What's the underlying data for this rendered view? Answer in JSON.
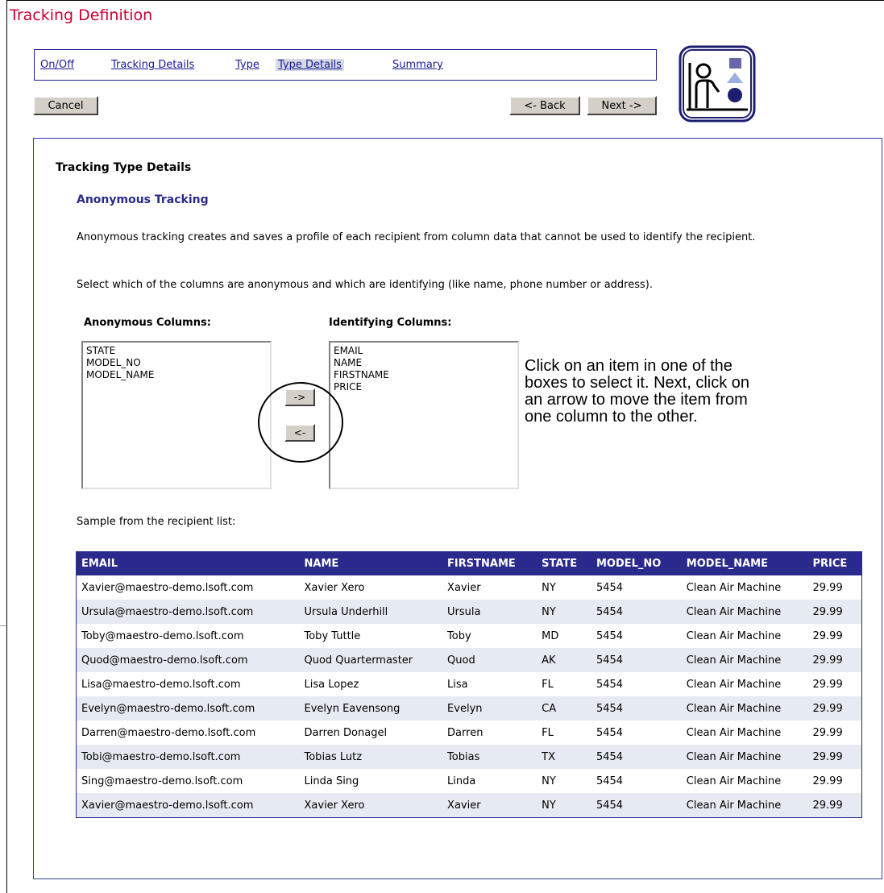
{
  "page": {
    "title": "Tracking Definition"
  },
  "wizard": {
    "tabs": [
      {
        "label": "On/Off"
      },
      {
        "label": "Tracking Details"
      },
      {
        "label": "Type"
      },
      {
        "label": "Type Details"
      },
      {
        "label": "Summary"
      }
    ],
    "active_tab": "Type Details",
    "cancel_label": "Cancel",
    "back_label": "<- Back",
    "next_label": "Next ->"
  },
  "logo": {
    "icon": "presenter-with-shapes-icon"
  },
  "content": {
    "section_title": "Tracking Type Details",
    "subtitle": "Anonymous Tracking",
    "description": "Anonymous tracking creates and saves a profile of each recipient from column data that cannot be used to identify the recipient.",
    "instruction": "Select which of the columns are anonymous and which are identifying (like name, phone number or address).",
    "anonymous_label": "Anonymous Columns:",
    "identifying_label": "Identifying Columns:",
    "anonymous_columns": [
      "STATE",
      "MODEL_NO",
      "MODEL_NAME"
    ],
    "identifying_columns": [
      "EMAIL",
      "NAME",
      "FIRSTNAME",
      "PRICE"
    ],
    "move_right_label": "->",
    "move_left_label": "<-",
    "hint": "Click on an item in one of the boxes to select it. Next, click on an arrow to move the item from one column to the other.",
    "sample_label": "Sample from the recipient list:"
  },
  "sample_table": {
    "headers": [
      "EMAIL",
      "NAME",
      "FIRSTNAME",
      "STATE",
      "MODEL_NO",
      "MODEL_NAME",
      "PRICE"
    ],
    "rows": [
      [
        "Xavier@maestro-demo.lsoft.com",
        "Xavier Xero",
        "Xavier",
        "NY",
        "5454",
        "Clean Air Machine",
        "29.99"
      ],
      [
        "Ursula@maestro-demo.lsoft.com",
        "Ursula Underhill",
        "Ursula",
        "NY",
        "5454",
        "Clean Air Machine",
        "29.99"
      ],
      [
        "Toby@maestro-demo.lsoft.com",
        "Toby Tuttle",
        "Toby",
        "MD",
        "5454",
        "Clean Air Machine",
        "29.99"
      ],
      [
        "Quod@maestro-demo.lsoft.com",
        "Quod Quartermaster",
        "Quod",
        "AK",
        "5454",
        "Clean Air Machine",
        "29.99"
      ],
      [
        "Lisa@maestro-demo.lsoft.com",
        "Lisa Lopez",
        "Lisa",
        "FL",
        "5454",
        "Clean Air Machine",
        "29.99"
      ],
      [
        "Evelyn@maestro-demo.lsoft.com",
        "Evelyn Eavensong",
        "Evelyn",
        "CA",
        "5454",
        "Clean Air Machine",
        "29.99"
      ],
      [
        "Darren@maestro-demo.lsoft.com",
        "Darren Donagel",
        "Darren",
        "FL",
        "5454",
        "Clean Air Machine",
        "29.99"
      ],
      [
        "Tobi@maestro-demo.lsoft.com",
        "Tobias Lutz",
        "Tobias",
        "TX",
        "5454",
        "Clean Air Machine",
        "29.99"
      ],
      [
        "Sing@maestro-demo.lsoft.com",
        "Linda Sing",
        "Linda",
        "NY",
        "5454",
        "Clean Air Machine",
        "29.99"
      ],
      [
        "Xavier@maestro-demo.lsoft.com",
        "Xavier Xero",
        "Xavier",
        "NY",
        "5454",
        "Clean Air Machine",
        "29.99"
      ]
    ]
  },
  "colors": {
    "title": "#cc0033",
    "accent": "#2a2a8c",
    "row_alt": "#e6eaf2"
  }
}
